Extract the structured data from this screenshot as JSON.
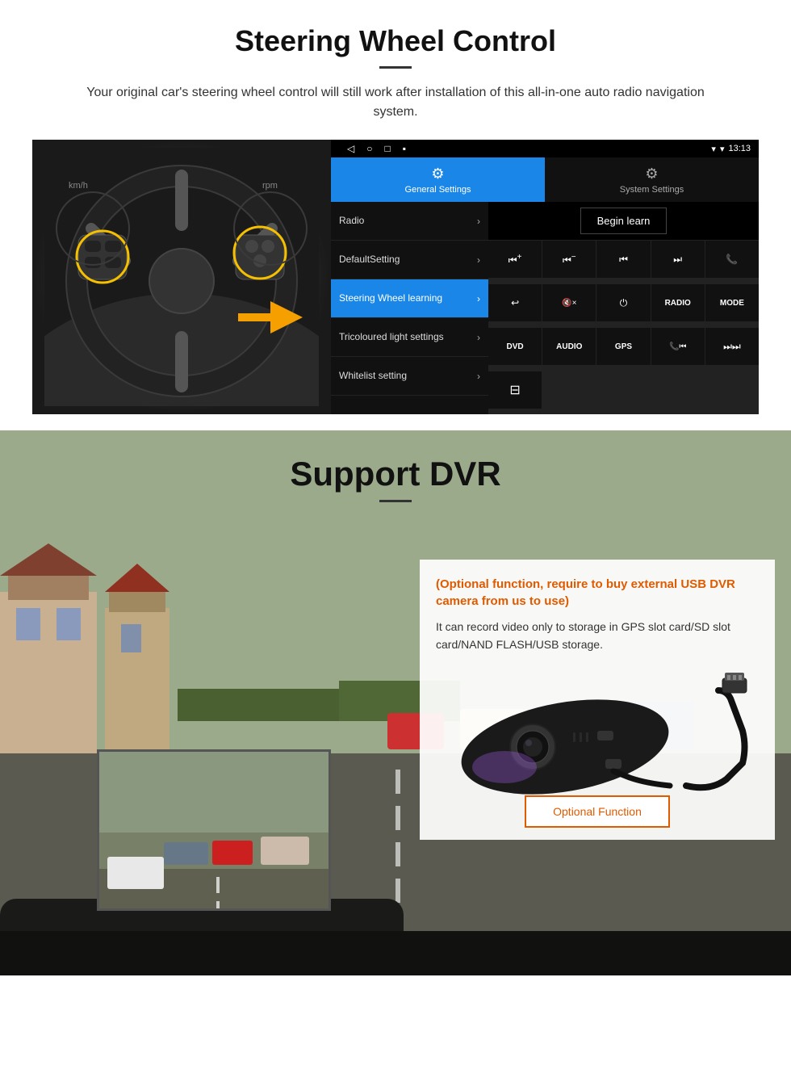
{
  "steering": {
    "title": "Steering Wheel Control",
    "description": "Your original car's steering wheel control will still work after installation of this all-in-one auto radio navigation system.",
    "statusbar": {
      "time": "13:13",
      "signal": "▾",
      "wifi": "▾"
    },
    "tabs": {
      "general": "General Settings",
      "system": "System Settings"
    },
    "menu_items": [
      {
        "label": "Radio",
        "active": false
      },
      {
        "label": "DefaultSetting",
        "active": false
      },
      {
        "label": "Steering Wheel learning",
        "active": true
      },
      {
        "label": "Tricoloured light settings",
        "active": false
      },
      {
        "label": "Whitelist setting",
        "active": false
      }
    ],
    "begin_learn": "Begin learn",
    "control_buttons": [
      "⏮+",
      "⏮-",
      "⏮",
      "⏭",
      "📞",
      "↩",
      "🔇×",
      "⏻",
      "RADIO",
      "MODE",
      "DVD",
      "AUDIO",
      "GPS",
      "📞⏮",
      "⏭⏭"
    ]
  },
  "dvr": {
    "title": "Support DVR",
    "optional_text": "(Optional function, require to buy external USB DVR camera from us to use)",
    "description": "It can record video only to storage in GPS slot card/SD slot card/NAND FLASH/USB storage.",
    "optional_button": "Optional Function"
  }
}
